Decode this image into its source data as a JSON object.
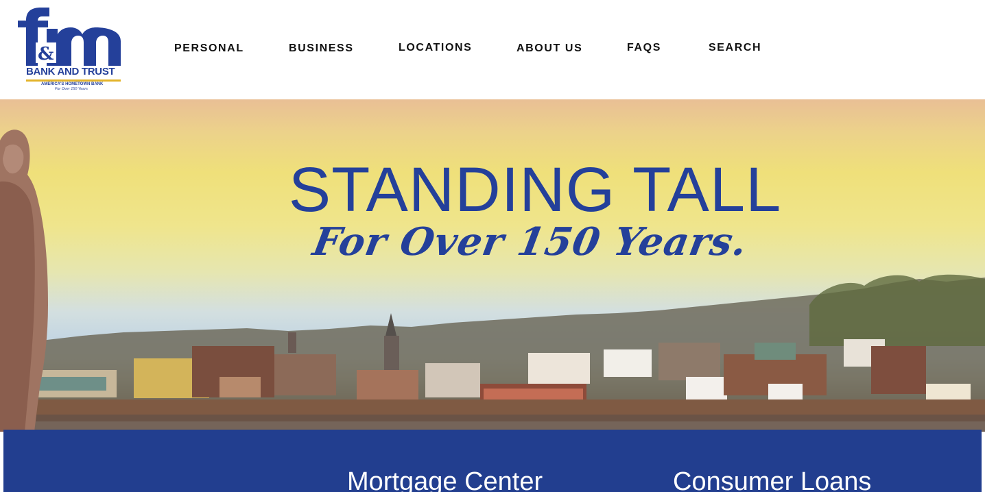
{
  "logo": {
    "mark": "fm",
    "ampersand": "&",
    "bank_name": "BANK AND TRUST",
    "tagline": "AMERICA'S HOMETOWN BANK",
    "tagline2": "For Over 150 Years"
  },
  "nav": {
    "items": [
      {
        "label": "PERSONAL"
      },
      {
        "label": "BUSINESS"
      },
      {
        "label": "LOCATIONS"
      },
      {
        "label": "ABOUT US"
      },
      {
        "label": "FAQS"
      },
      {
        "label": "SEARCH"
      }
    ]
  },
  "hero": {
    "title": "STANDING TALL",
    "subtitle": "For Over 150 Years."
  },
  "band": {
    "links": [
      {
        "label": "Mortgage Center"
      },
      {
        "label": "Consumer Loans"
      }
    ]
  },
  "colors": {
    "brand_blue": "#24409a",
    "band_blue": "#223e8f",
    "logo_gold": "#e3b329"
  }
}
